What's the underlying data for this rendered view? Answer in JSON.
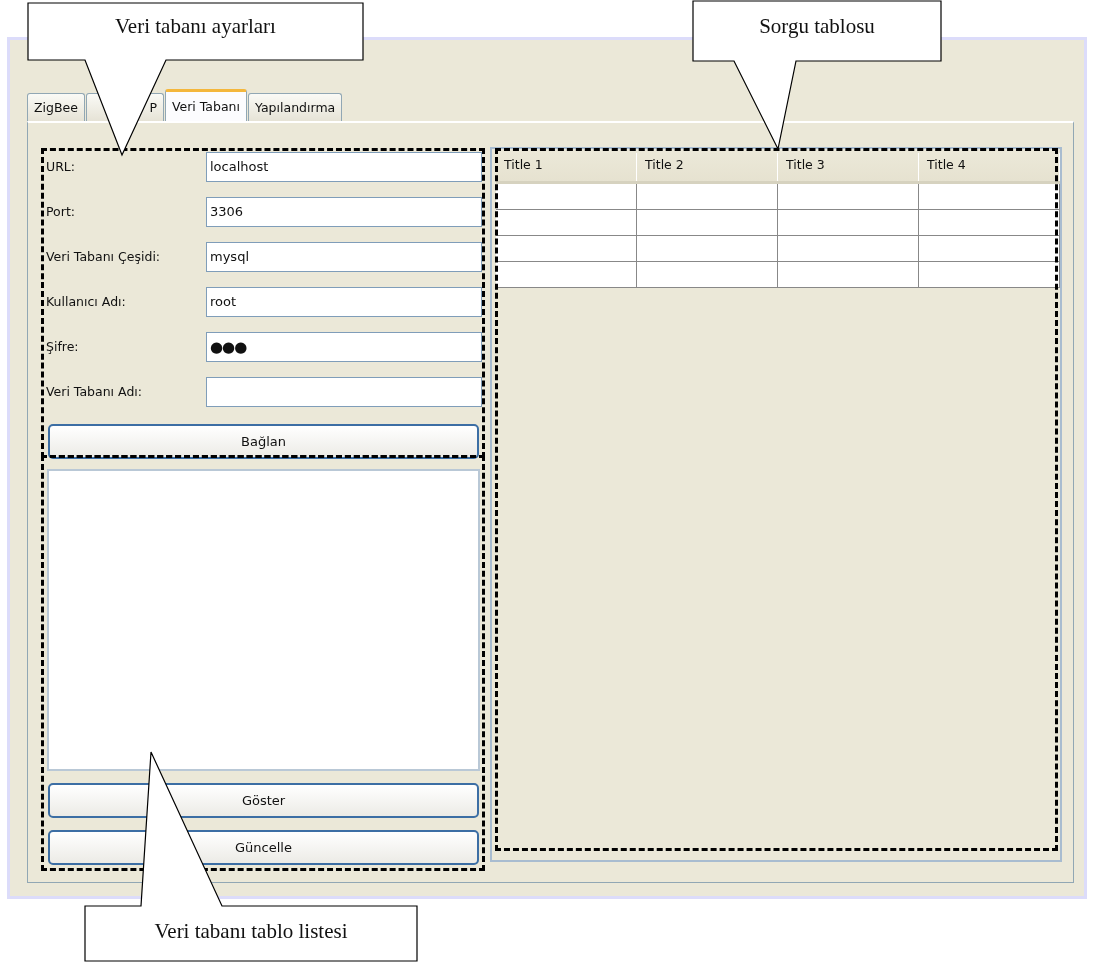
{
  "tabs": [
    {
      "label": "ZigBee",
      "selected": false
    },
    {
      "label": "P",
      "selected": false
    },
    {
      "label": "Veri Tabanı",
      "selected": true
    },
    {
      "label": "Yapılandırma",
      "selected": false
    }
  ],
  "settings": {
    "fields": [
      {
        "label": "URL:",
        "value": "localhost",
        "kind": "text"
      },
      {
        "label": "Port:",
        "value": "3306",
        "kind": "text"
      },
      {
        "label": "Veri Tabanı Çeşidi:",
        "value": "mysql",
        "kind": "text"
      },
      {
        "label": "Kullanıcı Adı:",
        "value": "root",
        "kind": "text"
      },
      {
        "label": "Şifre:",
        "value": "●●●",
        "kind": "password"
      },
      {
        "label": "Veri Tabanı Adı:",
        "kind": "text"
      }
    ],
    "connect_button": "Bağlan"
  },
  "table_list": {
    "buttons": [
      "Göster",
      "Güncelle"
    ]
  },
  "query_table": {
    "columns": [
      "Title 1",
      "Title 2",
      "Title 3",
      "Title 4"
    ]
  },
  "annotations": [
    {
      "text": "Veri tabanı ayarları"
    },
    {
      "text": "Sorgu tablosu"
    },
    {
      "text": "Veri tabanı tablo listesi"
    }
  ]
}
